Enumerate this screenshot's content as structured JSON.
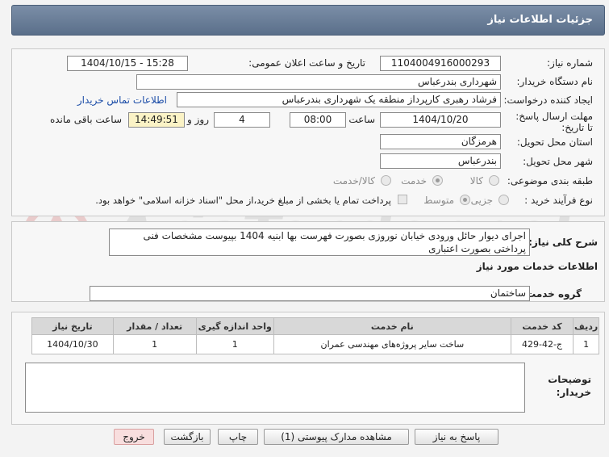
{
  "header": {
    "title": "جزئیات اطلاعات نیاز"
  },
  "fields": {
    "need_number_label": "شماره نیاز:",
    "need_number": "1104004916000293",
    "announce_label": "تاریخ و ساعت اعلان عمومی:",
    "announce_value": "1404/10/15 - 15:28",
    "buyer_label": "نام دستگاه خریدار:",
    "buyer_value": "شهرداری بندرعباس",
    "creator_label": "ایجاد کننده درخواست:",
    "creator_value": "فرشاد رهبری کارپرداز منطقه یک شهرداری بندرعباس",
    "contact_link": "اطلاعات تماس خریدار",
    "deadline_label": "مهلت ارسال پاسخ: تا تاریخ:",
    "deadline_date": "1404/10/20",
    "time_label": "ساعت",
    "deadline_time": "08:00",
    "days_value": "4",
    "days_label": "روز و",
    "remaining_time": "14:49:51",
    "remaining_label": "ساعت باقی مانده",
    "province_label": "استان محل تحویل:",
    "province_value": "هرمزگان",
    "city_label": "شهر محل تحویل:",
    "city_value": "بندرعباس",
    "category_label": "طبقه بندی موضوعی:",
    "category_options": [
      "کالا",
      "خدمت",
      "کالا/خدمت"
    ],
    "category_selected": "خدمت",
    "process_label": "نوع فرآیند خرید :",
    "process_options": [
      "جزیی",
      "متوسط"
    ],
    "process_selected": "متوسط",
    "payment_note": "پرداخت تمام یا بخشی از مبلغ خرید،از محل \"اسناد خزانه اسلامی\" خواهد بود."
  },
  "description": {
    "label": "شرح کلی نیاز:",
    "value": "اجرای دیوار حائل ورودی خیابان نوروزی بصورت فهرست بها ابنیه 1404 بپیوست مشخصات فنی پرداختی بصورت اعتباری"
  },
  "services": {
    "section_title": "اطلاعات خدمات مورد نیاز",
    "group_label": "گروه خدمت:",
    "group_value": "ساختمان",
    "columns": [
      "ردیف",
      "کد خدمت",
      "نام خدمت",
      "واحد اندازه گیری",
      "تعداد / مقدار",
      "تاریخ نیاز"
    ],
    "rows": [
      {
        "row": "1",
        "code": "ج-42-429",
        "name": "ساخت سایر پروژه‌های مهندسی عمران",
        "unit": "1",
        "qty": "1",
        "date": "1404/10/30"
      }
    ]
  },
  "buyer_notes": {
    "label_line1": "توضیحات",
    "label_line2": "خریدار:",
    "value": ""
  },
  "buttons": {
    "reply": "پاسخ به نیاز",
    "view_docs": "مشاهده مدارک پیوستی (1)",
    "print": "چاپ",
    "back": "بازگشت",
    "exit": "خروج"
  },
  "colors": {
    "header_bg": "#6a7e99",
    "highlight": "#fbf3c6",
    "link": "#1d4ea8",
    "exit_button": "#f8dede"
  }
}
